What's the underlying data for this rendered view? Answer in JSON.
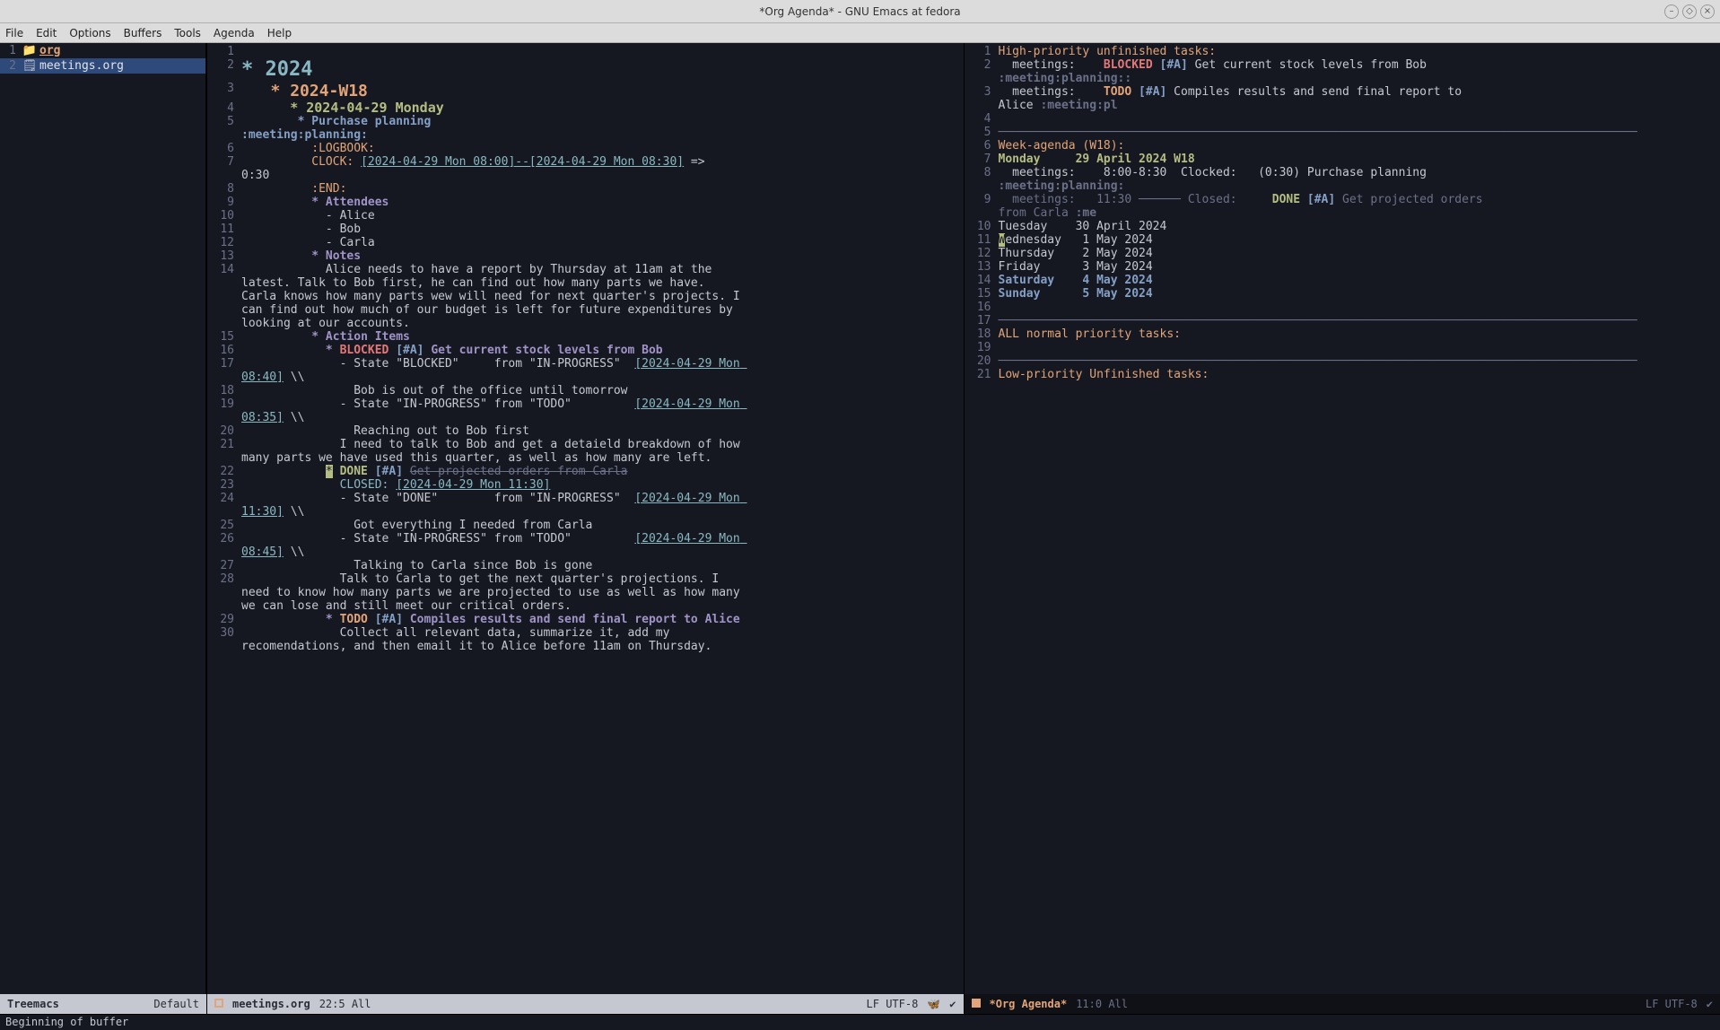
{
  "window": {
    "title": "*Org Agenda* - GNU Emacs at fedora"
  },
  "menu": [
    "File",
    "Edit",
    "Options",
    "Buffers",
    "Tools",
    "Agenda",
    "Help"
  ],
  "sidebar": {
    "items": [
      {
        "ln": "1",
        "icon": "📁",
        "label": "org",
        "kind": "dir"
      },
      {
        "ln": "2",
        "icon": "🗒",
        "label": "meetings.org",
        "kind": "file",
        "selected": true
      }
    ],
    "modeline_name": "Treemacs",
    "modeline_mode": "Default"
  },
  "editor": {
    "lines": [
      {
        "n": "1",
        "segs": []
      },
      {
        "n": "2",
        "cls": "h1",
        "segs": [
          {
            "t": "* 2024"
          }
        ]
      },
      {
        "n": "3",
        "cls": "h2",
        "segs": [
          {
            "t": "   * 2024-W18"
          }
        ]
      },
      {
        "n": "4",
        "cls": "h3",
        "segs": [
          {
            "t": "      * 2024-04-29 Monday"
          }
        ]
      },
      {
        "n": "5",
        "segs": [
          {
            "t": "        ",
            "c": ""
          },
          {
            "t": "* Purchase planning",
            "c": "h4"
          },
          {
            "t": "                             ",
            "c": ""
          },
          {
            "t": ":meeting:planning:",
            "c": "h4"
          }
        ]
      },
      {
        "n": "6",
        "segs": [
          {
            "t": "          ",
            "c": ""
          },
          {
            "t": ":LOGBOOK:",
            "c": "drawer"
          }
        ]
      },
      {
        "n": "7",
        "segs": [
          {
            "t": "          CLOCK: ",
            "c": "drawer"
          },
          {
            "t": "[2024-04-29 Mon 08:00]--[2024-04-29 Mon 08:30]",
            "c": "ts-link"
          },
          {
            "t": " =>  0:30",
            "c": ""
          }
        ]
      },
      {
        "n": "8",
        "segs": [
          {
            "t": "          ",
            "c": ""
          },
          {
            "t": ":END:",
            "c": "drawer"
          }
        ]
      },
      {
        "n": "9",
        "segs": [
          {
            "t": "          ",
            "c": ""
          },
          {
            "t": "* Attendees",
            "c": "h5"
          }
        ]
      },
      {
        "n": "10",
        "segs": [
          {
            "t": "            - Alice"
          }
        ]
      },
      {
        "n": "11",
        "segs": [
          {
            "t": "            - Bob"
          }
        ]
      },
      {
        "n": "12",
        "segs": [
          {
            "t": "            - Carla"
          }
        ]
      },
      {
        "n": "13",
        "segs": [
          {
            "t": "          ",
            "c": ""
          },
          {
            "t": "* Notes",
            "c": "h5"
          }
        ]
      },
      {
        "n": "14",
        "segs": [
          {
            "t": "            Alice needs to have a report by Thursday at 11am at the latest. Talk to Bob first, he can find out how many parts we have. Carla knows how many parts wew will need for next quarter's projects. I can find out how much of our budget is left for future expenditures by looking at our accounts."
          }
        ]
      },
      {
        "n": "15",
        "segs": [
          {
            "t": "          ",
            "c": ""
          },
          {
            "t": "* Action Items",
            "c": "h5"
          }
        ]
      },
      {
        "n": "16",
        "segs": [
          {
            "t": "            ",
            "c": ""
          },
          {
            "t": "* ",
            "c": "h5"
          },
          {
            "t": "BLOCKED",
            "c": "todo-blocked"
          },
          {
            "t": " ",
            "c": ""
          },
          {
            "t": "[#A]",
            "c": "prio"
          },
          {
            "t": " Get current stock levels from Bob",
            "c": "h5"
          }
        ]
      },
      {
        "n": "17",
        "segs": [
          {
            "t": "              - State \"BLOCKED\"     from \"IN-PROGRESS\"  "
          },
          {
            "t": "[2024-04-29 Mon 08:40]",
            "c": "ts-link"
          },
          {
            "t": " \\\\"
          }
        ]
      },
      {
        "n": "18",
        "segs": [
          {
            "t": "                Bob is out of the office until tomorrow"
          }
        ]
      },
      {
        "n": "19",
        "segs": [
          {
            "t": "              - State \"IN-PROGRESS\" from \"TODO\"         "
          },
          {
            "t": "[2024-04-29 Mon 08:35]",
            "c": "ts-link"
          },
          {
            "t": " \\\\"
          }
        ]
      },
      {
        "n": "20",
        "segs": [
          {
            "t": "                Reaching out to Bob first"
          }
        ]
      },
      {
        "n": "21",
        "segs": [
          {
            "t": "              I need to talk to Bob and get a detaield breakdown of how many parts we have used this quarter, as well as how many are left."
          }
        ]
      },
      {
        "n": "22",
        "segs": [
          {
            "t": "            ",
            "c": ""
          },
          {
            "t": "*",
            "c": "cursor-mark"
          },
          {
            "t": " ",
            "c": ""
          },
          {
            "t": "DONE",
            "c": "todo-done"
          },
          {
            "t": " ",
            "c": ""
          },
          {
            "t": "[#A]",
            "c": "prio"
          },
          {
            "t": " ",
            "c": ""
          },
          {
            "t": "Get projected orders from Carla",
            "c": "strike"
          }
        ]
      },
      {
        "n": "23",
        "segs": [
          {
            "t": "              "
          },
          {
            "t": "CLOSED:",
            "c": "closed-label"
          },
          {
            "t": " "
          },
          {
            "t": "[2024-04-29 Mon 11:30]",
            "c": "ts-link"
          }
        ]
      },
      {
        "n": "24",
        "segs": [
          {
            "t": "              - State \"DONE\"        from \"IN-PROGRESS\"  "
          },
          {
            "t": "[2024-04-29 Mon 11:30]",
            "c": "ts-link"
          },
          {
            "t": " \\\\"
          }
        ]
      },
      {
        "n": "25",
        "segs": [
          {
            "t": "                Got everything I needed from Carla"
          }
        ]
      },
      {
        "n": "26",
        "segs": [
          {
            "t": "              - State \"IN-PROGRESS\" from \"TODO\"         "
          },
          {
            "t": "[2024-04-29 Mon 08:45]",
            "c": "ts-link"
          },
          {
            "t": " \\\\"
          }
        ]
      },
      {
        "n": "27",
        "segs": [
          {
            "t": "                Talking to Carla since Bob is gone"
          }
        ]
      },
      {
        "n": "28",
        "segs": [
          {
            "t": "              Talk to Carla to get the next quarter's projections. I need to know how many parts we are projected to use as well as how many we can lose and still meet our critical orders."
          }
        ]
      },
      {
        "n": "29",
        "segs": [
          {
            "t": "            ",
            "c": ""
          },
          {
            "t": "* ",
            "c": "h5"
          },
          {
            "t": "TODO",
            "c": "todo-todo"
          },
          {
            "t": " ",
            "c": ""
          },
          {
            "t": "[#A]",
            "c": "prio"
          },
          {
            "t": " Compiles results and send final report to Alice",
            "c": "h5"
          }
        ]
      },
      {
        "n": "30",
        "segs": [
          {
            "t": "              Collect all relevant data, summarize it, add my recomendations, and then email it to Alice before 11am on Thursday."
          }
        ]
      }
    ],
    "modeline": {
      "buffer": "meetings.org",
      "pos": "22:5 All",
      "encoding": "LF UTF-8"
    }
  },
  "agenda": {
    "lines": [
      {
        "n": "1",
        "segs": [
          {
            "t": "High-priority unfinished tasks:",
            "c": "agenda-header"
          }
        ]
      },
      {
        "n": "2",
        "segs": [
          {
            "t": "  meetings:    "
          },
          {
            "t": "BLOCKED",
            "c": "todo-blocked"
          },
          {
            "t": " "
          },
          {
            "t": "[#A]",
            "c": "prio"
          },
          {
            "t": " Get current stock levels from Bob       "
          },
          {
            "t": ":meeting:planning::",
            "c": "tag"
          }
        ]
      },
      {
        "n": "3",
        "segs": [
          {
            "t": "  meetings:    "
          },
          {
            "t": "TODO",
            "c": "todo-todo"
          },
          {
            "t": " "
          },
          {
            "t": "[#A]",
            "c": "prio"
          },
          {
            "t": " Compiles results and send final report to Alice "
          },
          {
            "t": ":meeting:pl",
            "c": "tag"
          }
        ]
      },
      {
        "n": "4",
        "segs": []
      },
      {
        "n": "5",
        "segs": [
          {
            "t": "───────────────────────────────────────────────────────────────────────────────────────────",
            "c": "agenda-divider"
          }
        ]
      },
      {
        "n": "6",
        "segs": [
          {
            "t": "Week-agenda (W18):",
            "c": "agenda-header"
          }
        ]
      },
      {
        "n": "7",
        "segs": [
          {
            "t": "Monday     29 April 2024 W18",
            "c": "agenda-today"
          }
        ]
      },
      {
        "n": "8",
        "segs": [
          {
            "t": "  meetings:    8:00-8:30  Clocked:   (0:30) Purchase planning    "
          },
          {
            "t": ":meeting:planning:",
            "c": "tag"
          }
        ]
      },
      {
        "n": "9",
        "segs": [
          {
            "t": "  meetings:   11:30 ",
            "c": "dim"
          },
          {
            "t": "──────",
            "c": "dim"
          },
          {
            "t": " Closed:     ",
            "c": "dim"
          },
          {
            "t": "DONE",
            "c": "todo-done"
          },
          {
            "t": " ",
            "c": ""
          },
          {
            "t": "[#A]",
            "c": "prio"
          },
          {
            "t": " Get projected orders from Carla ",
            "c": "dim"
          },
          {
            "t": ":me",
            "c": "tag"
          }
        ]
      },
      {
        "n": "10",
        "segs": [
          {
            "t": "Tuesday    30 April 2024",
            "c": "agenda-cat"
          }
        ]
      },
      {
        "n": "11",
        "segs": [
          {
            "t": "W",
            "c": "cursor-mark"
          },
          {
            "t": "ednesday   1 May 2024",
            "c": "agenda-cat"
          }
        ]
      },
      {
        "n": "12",
        "segs": [
          {
            "t": "Thursday    2 May 2024",
            "c": "agenda-cat"
          }
        ]
      },
      {
        "n": "13",
        "segs": [
          {
            "t": "Friday      3 May 2024",
            "c": "agenda-cat"
          }
        ]
      },
      {
        "n": "14",
        "segs": [
          {
            "t": "Saturday    4 May 2024",
            "c": "agenda-weekend"
          }
        ]
      },
      {
        "n": "15",
        "segs": [
          {
            "t": "Sunday      5 May 2024",
            "c": "agenda-weekend"
          }
        ]
      },
      {
        "n": "16",
        "segs": []
      },
      {
        "n": "17",
        "segs": [
          {
            "t": "───────────────────────────────────────────────────────────────────────────────────────────",
            "c": "agenda-divider"
          }
        ]
      },
      {
        "n": "18",
        "segs": [
          {
            "t": "ALL normal priority tasks:",
            "c": "agenda-header"
          }
        ]
      },
      {
        "n": "19",
        "segs": []
      },
      {
        "n": "20",
        "segs": [
          {
            "t": "───────────────────────────────────────────────────────────────────────────────────────────",
            "c": "agenda-divider"
          }
        ]
      },
      {
        "n": "21",
        "segs": [
          {
            "t": "Low-priority Unfinished tasks:",
            "c": "agenda-header"
          }
        ]
      }
    ],
    "modeline": {
      "buffer": "*Org Agenda*",
      "pos": "11:0 All",
      "encoding": "LF UTF-8"
    }
  },
  "minibuffer": "Beginning of buffer"
}
